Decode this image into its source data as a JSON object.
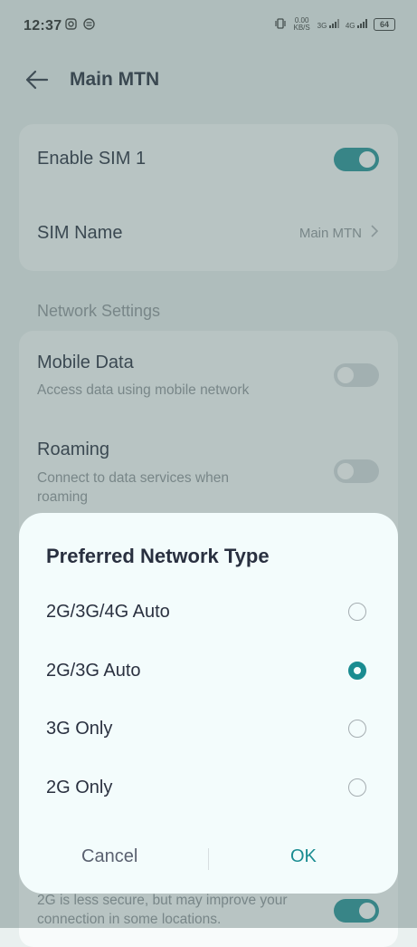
{
  "status_bar": {
    "time": "12:37",
    "notification_icons": [
      "instagram-icon",
      "app-icon"
    ],
    "speed": "0.00 KB/S",
    "net1": "3G",
    "net2": "4G",
    "battery": "64"
  },
  "app_bar": {
    "title": "Main MTN",
    "back_icon": "arrow-left-icon"
  },
  "sim_card": {
    "enable_label": "Enable SIM 1",
    "enable_on": true,
    "name_label": "SIM Name",
    "name_value": "Main MTN"
  },
  "network_section": {
    "title": "Network Settings",
    "mobile_data_label": "Mobile Data",
    "mobile_data_sub": "Access data using mobile network",
    "mobile_data_on": false,
    "roaming_label": "Roaming",
    "roaming_sub": "Connect to data services when roaming",
    "roaming_on": false,
    "bottom_sub": "2G is less secure, but may improve your connection in some locations.",
    "bottom_on": true
  },
  "dialog": {
    "title": "Preferred Network Type",
    "options": [
      "2G/3G/4G Auto",
      "2G/3G Auto",
      "3G Only",
      "2G Only"
    ],
    "selected": "2G/3G Auto",
    "cancel": "Cancel",
    "ok": "OK"
  },
  "colors": {
    "accent": "#1a8c91",
    "background": "#e9f0ef",
    "card": "#f8fbfb",
    "dialog": "#f3fcfc"
  }
}
